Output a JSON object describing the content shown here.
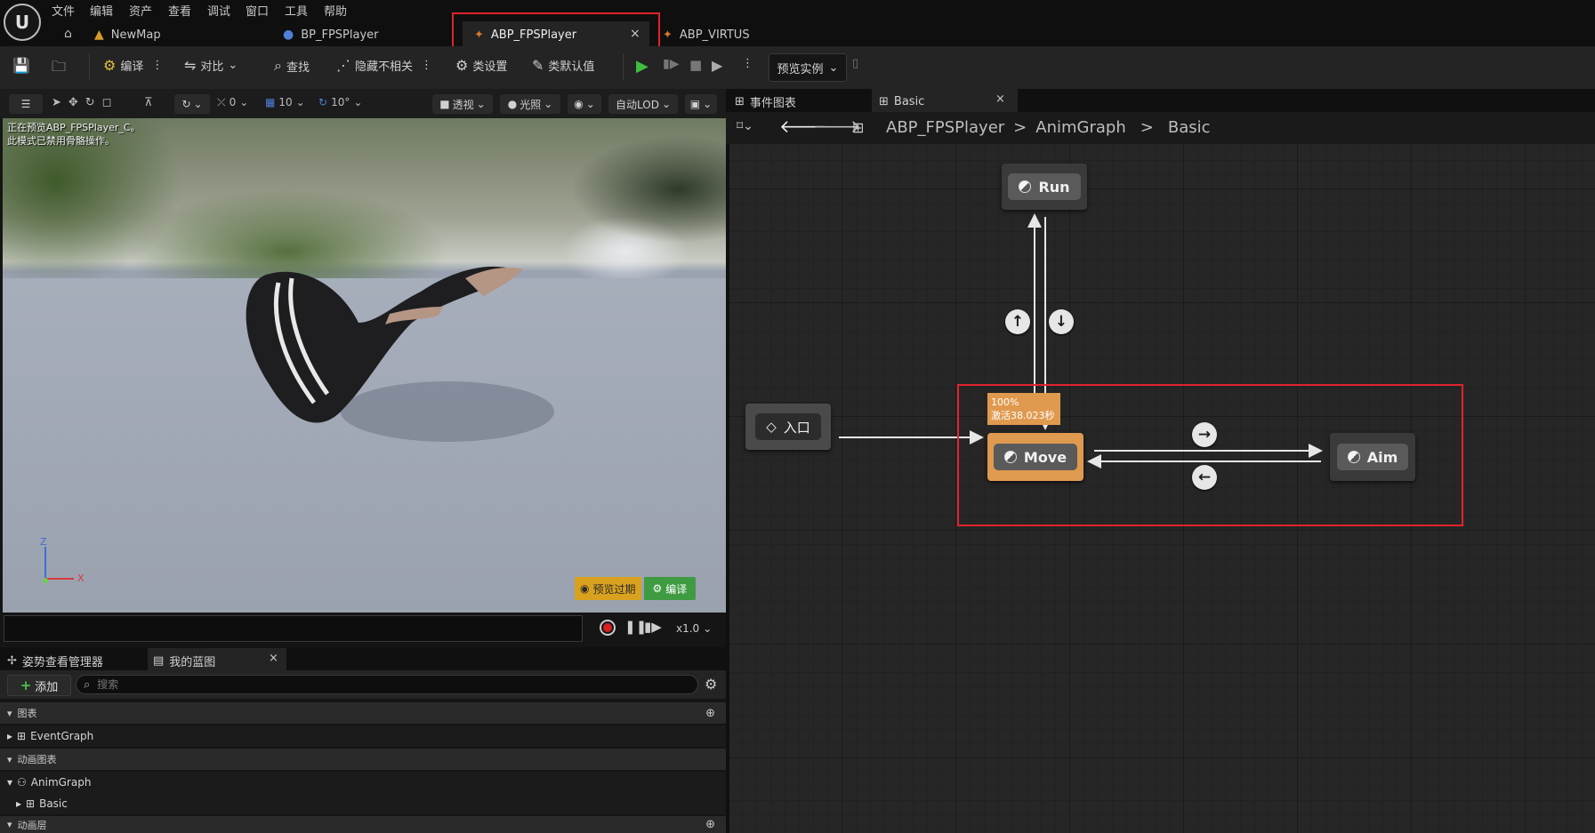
{
  "menu": [
    "文件",
    "编辑",
    "资产",
    "查看",
    "调试",
    "窗口",
    "工具",
    "帮助"
  ],
  "doc_tabs": [
    {
      "label": "NewMap",
      "icon": "level-icon"
    },
    {
      "label": "BP_FPSPlayer",
      "icon": "blueprint-character-icon"
    },
    {
      "label": "ABP_FPSPlayer",
      "icon": "anim-blueprint-icon",
      "active": true
    },
    {
      "label": "ABP_VIRTUS",
      "icon": "anim-blueprint-icon"
    }
  ],
  "tab_close": "×",
  "toolbar": {
    "compile": "编译",
    "diff": "对比",
    "find": "查找",
    "hide_unrelated": "隐藏不相关",
    "class_settings": "类设置",
    "class_defaults": "类默认值",
    "preview_instance": "预览实例"
  },
  "viewport_toolbar": {
    "snap_rotation": "0",
    "grid": "10",
    "angle": "10°",
    "perspective": "透视",
    "lit": "光照",
    "lod": "自动LOD"
  },
  "viewport": {
    "info_line1": "正在预览ABP_FPSPlayer_C。",
    "info_line2": "此模式已禁用骨骼操作。",
    "axis_z": "Z",
    "axis_x": "X",
    "badge_preview": "预览过期",
    "badge_compile": "编译"
  },
  "timeline": {
    "speed": "x1.0"
  },
  "bottom_panel": {
    "tab_pose": "姿势查看管理器",
    "tab_blueprint": "我的蓝图",
    "close": "×",
    "add": "添加",
    "search_placeholder": "搜索",
    "sections": {
      "graphs": "图表",
      "anim_graphs": "动画图表",
      "anim_layers": "动画层"
    },
    "items": {
      "event_graph": "EventGraph",
      "anim_graph": "AnimGraph",
      "basic": "Basic"
    }
  },
  "graph_panel": {
    "tab_event": "事件图表",
    "tab_basic": "Basic",
    "close": "×",
    "breadcrumb": [
      "ABP_FPSPlayer",
      "AnimGraph",
      "Basic"
    ],
    "sep": ">"
  },
  "graph": {
    "entry": "入口",
    "states": {
      "run": "Run",
      "move": "Move",
      "aim": "Aim"
    },
    "move_stat_line1": "100%",
    "move_stat_line2": "激活38.023秒",
    "colors": {
      "active_state": "#e09a4f",
      "state": "#3a3a3a",
      "highlight": "#e0242b"
    }
  }
}
